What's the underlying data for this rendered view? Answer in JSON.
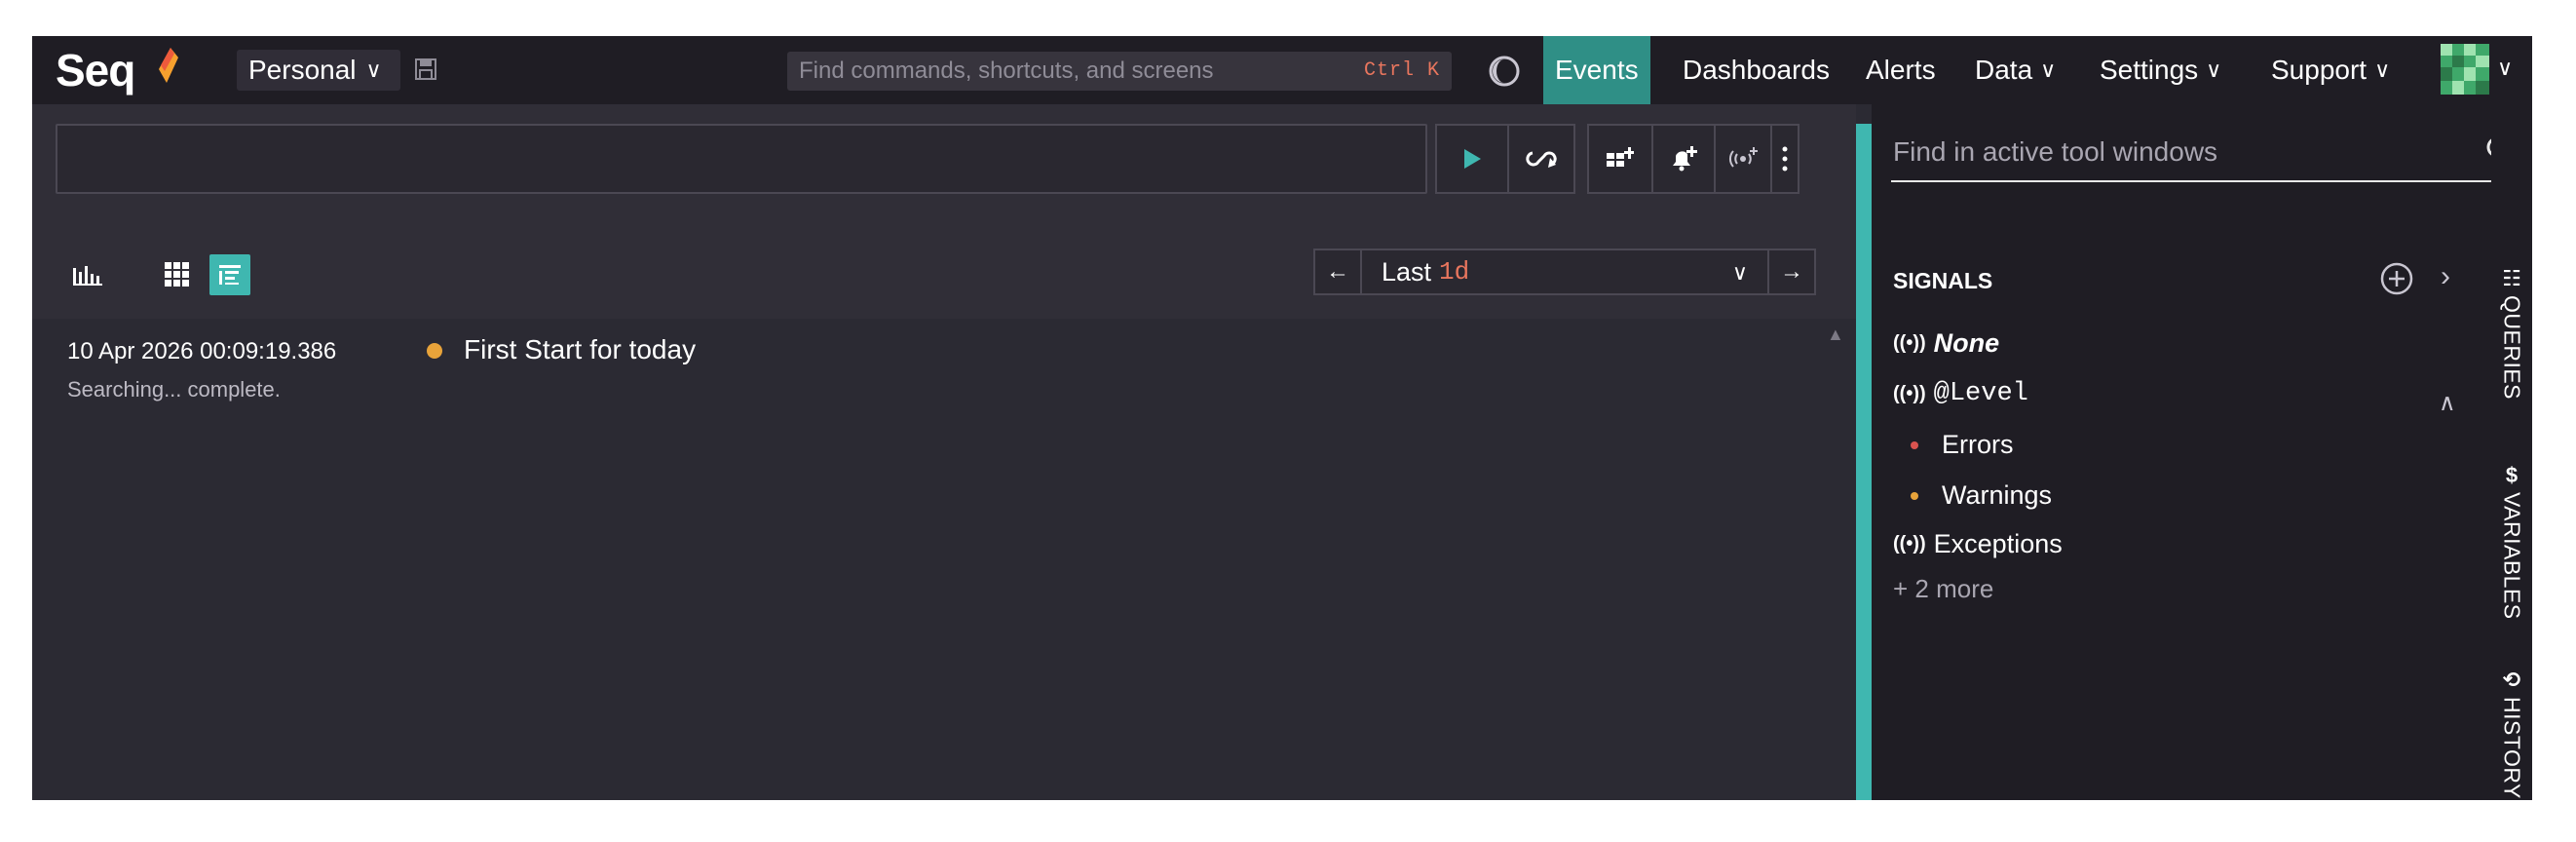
{
  "app": {
    "logo_text": "Seq",
    "workspace_label": "Personal"
  },
  "command_search": {
    "placeholder": "Find commands, shortcuts, and screens",
    "shortcut": "Ctrl K"
  },
  "nav": {
    "items": [
      {
        "label": "Events",
        "active": true
      },
      {
        "label": "Dashboards"
      },
      {
        "label": "Alerts"
      },
      {
        "label": "Data"
      },
      {
        "label": "Settings"
      },
      {
        "label": "Support"
      }
    ]
  },
  "filter": {
    "value": "",
    "placeholder": ""
  },
  "toolbar": {
    "icons": [
      "run-icon",
      "refresh-tail-icon",
      "add-to-dashboard-icon",
      "add-alert-icon",
      "add-signal-icon",
      "more-icon"
    ]
  },
  "views": {
    "icons": [
      "histogram-icon",
      "grid-icon",
      "list-icon"
    ],
    "active": "list-icon"
  },
  "range": {
    "prefix": "Last",
    "amount": "1d"
  },
  "events": [
    {
      "timestamp": "10 Apr 2026  00:09:19.386",
      "level_color": "#e8a33a",
      "message": "First Start for today"
    }
  ],
  "search_status": "Searching... complete.",
  "tool_panel": {
    "search_placeholder": "Find in active tool windows",
    "signals_title": "SIGNALS",
    "signals": {
      "none": "None",
      "level": "@Level",
      "errors": "Errors",
      "warnings": "Warnings",
      "exceptions": "Exceptions",
      "more": "+ 2 more"
    },
    "colors": {
      "errors": "#d9534f",
      "warnings": "#e8a33a"
    }
  },
  "side_tabs": {
    "queries": "QUERIES",
    "variables": "VARIABLES",
    "history": "HISTORY"
  },
  "colors": {
    "accent": "#3fb7b0",
    "nav_active": "#2f8f86"
  }
}
